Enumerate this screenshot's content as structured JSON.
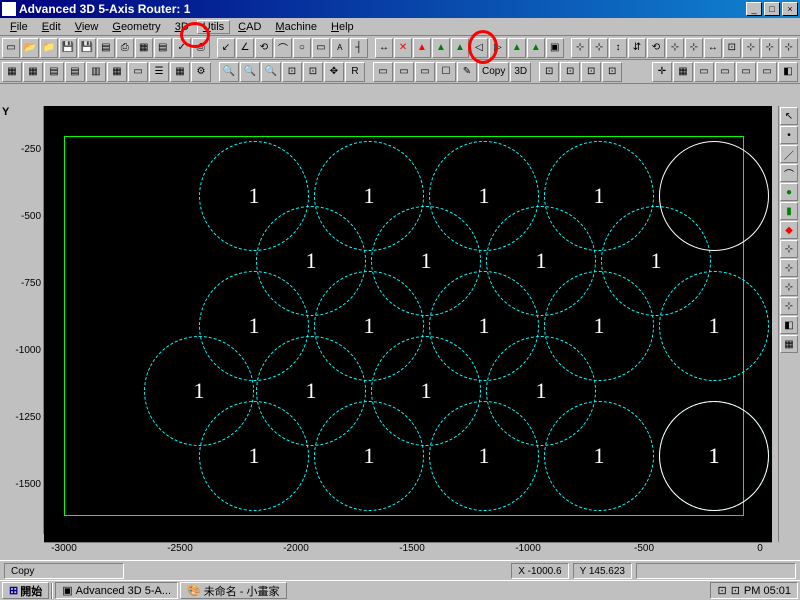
{
  "title": "Advanced 3D 5-Axis Router: 1",
  "menus": [
    "File",
    "Edit",
    "View",
    "Geometry",
    "3D",
    "Utils",
    "CAD",
    "Machine",
    "Help"
  ],
  "menu_selected_index": 5,
  "copy_btn": "Copy",
  "td_btn": "3D",
  "ruler_y_label": "Y",
  "ruler_y": [
    "-250",
    "-500",
    "-750",
    "-1000",
    "-1250",
    "-1500"
  ],
  "ruler_x": [
    "-3000",
    "-2500",
    "-2000",
    "-1500",
    "-1000",
    "-500",
    "0"
  ],
  "circle_label": "1",
  "status_mode": "Copy",
  "status_x": "X -1000.6",
  "status_y": "Y 145.623",
  "start_label": "開始",
  "task1": "Advanced 3D 5-A...",
  "task2": "未命名 - 小畫家",
  "clock": "PM 05:01",
  "colors": {
    "accent": "#000080",
    "canvas": "#000",
    "geom": "#0f0",
    "dash": "#0ff"
  }
}
